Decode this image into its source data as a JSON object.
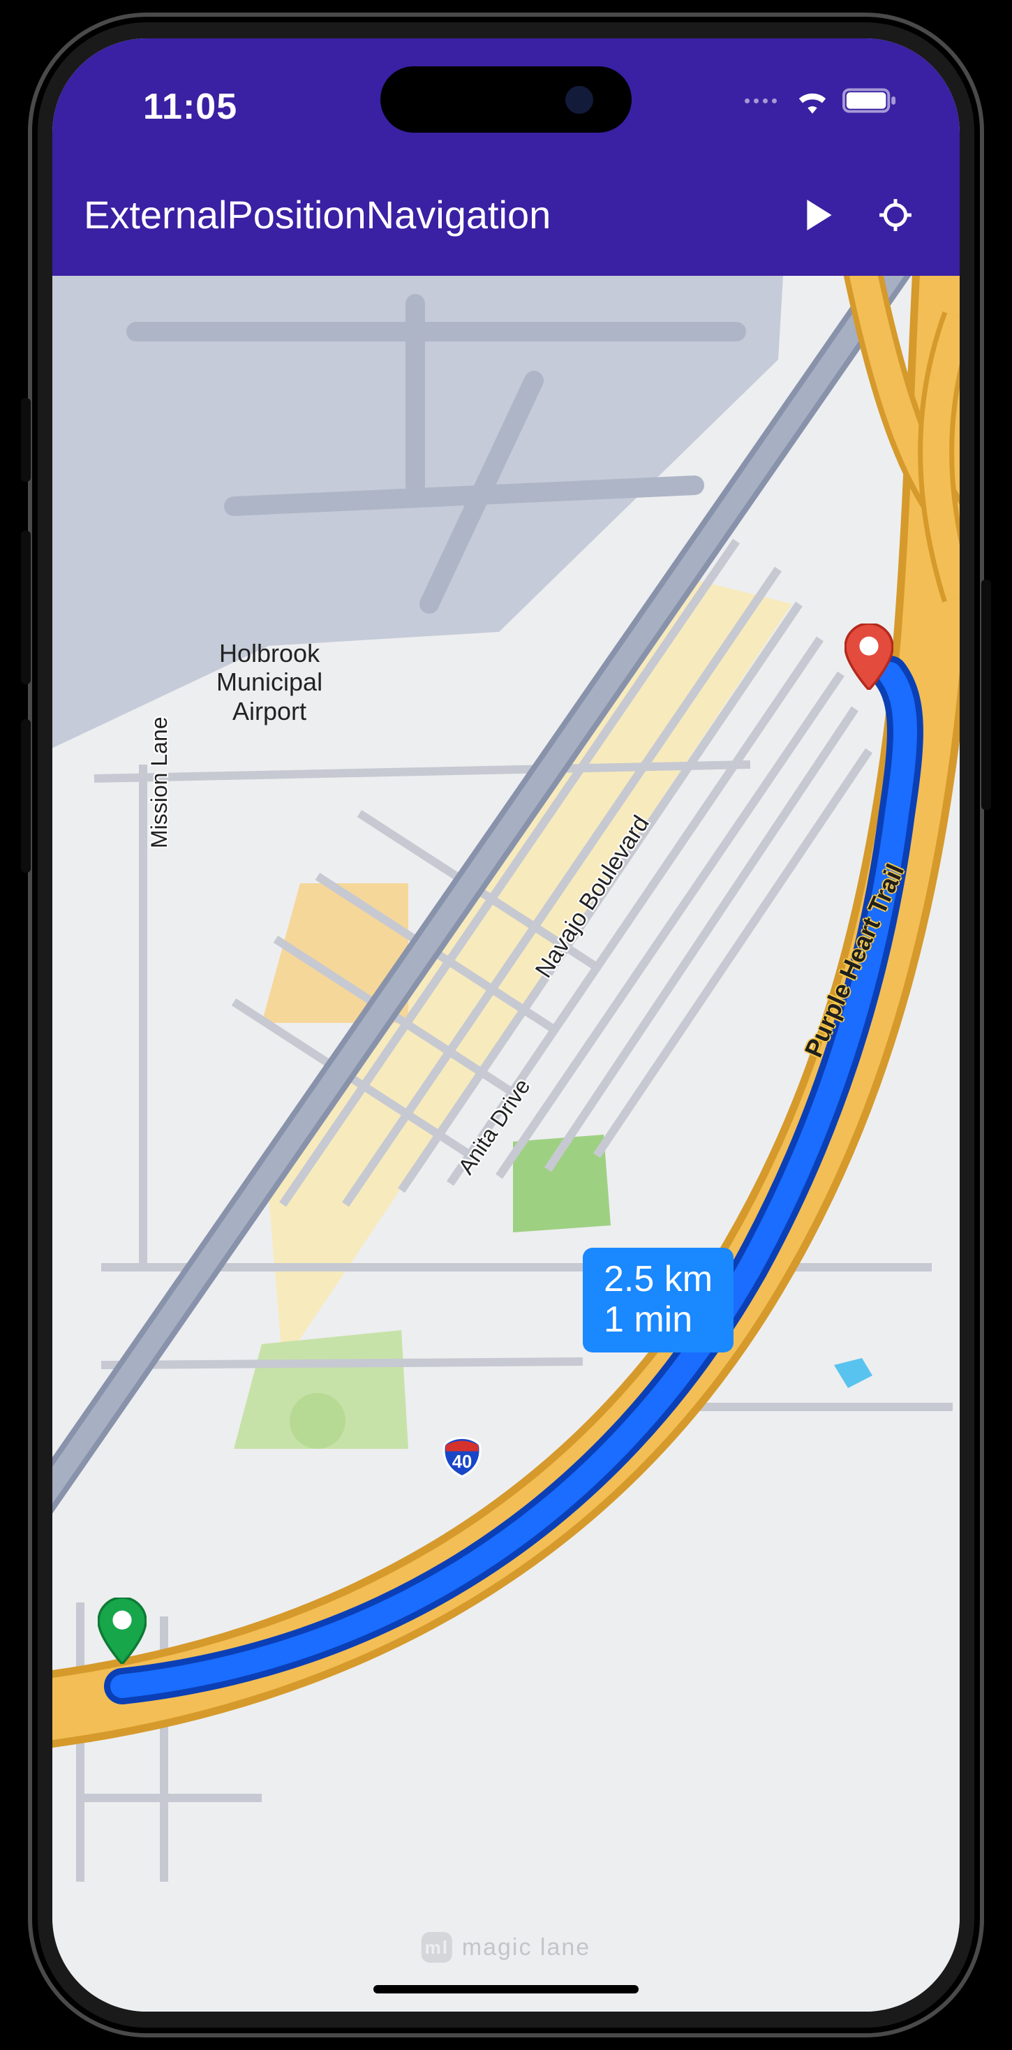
{
  "status": {
    "time": "11:05"
  },
  "appbar": {
    "title": "ExternalPositionNavigation"
  },
  "map": {
    "labels": {
      "airport": "Holbrook\nMunicipal\nAirport",
      "mission_lane": "Mission Lane",
      "navajo_blvd": "Navajo Boulevard",
      "anita_drive": "Anita Drive",
      "purple_heart_trail": "Purple Heart Trail"
    },
    "shield": {
      "interstate_number": "40"
    },
    "pins": {
      "start_color": "#17a64a",
      "end_color": "#e34b3d"
    }
  },
  "route_info": {
    "distance": "2.5 km",
    "duration": "1 min"
  },
  "colors": {
    "appbar_bg": "#3a20a3",
    "route_blue": "#1668ff",
    "highway_fill": "#f3be55",
    "highway_stroke": "#d59a2b",
    "info_box": "#1a88ff"
  },
  "watermark": {
    "text": "magic lane"
  }
}
